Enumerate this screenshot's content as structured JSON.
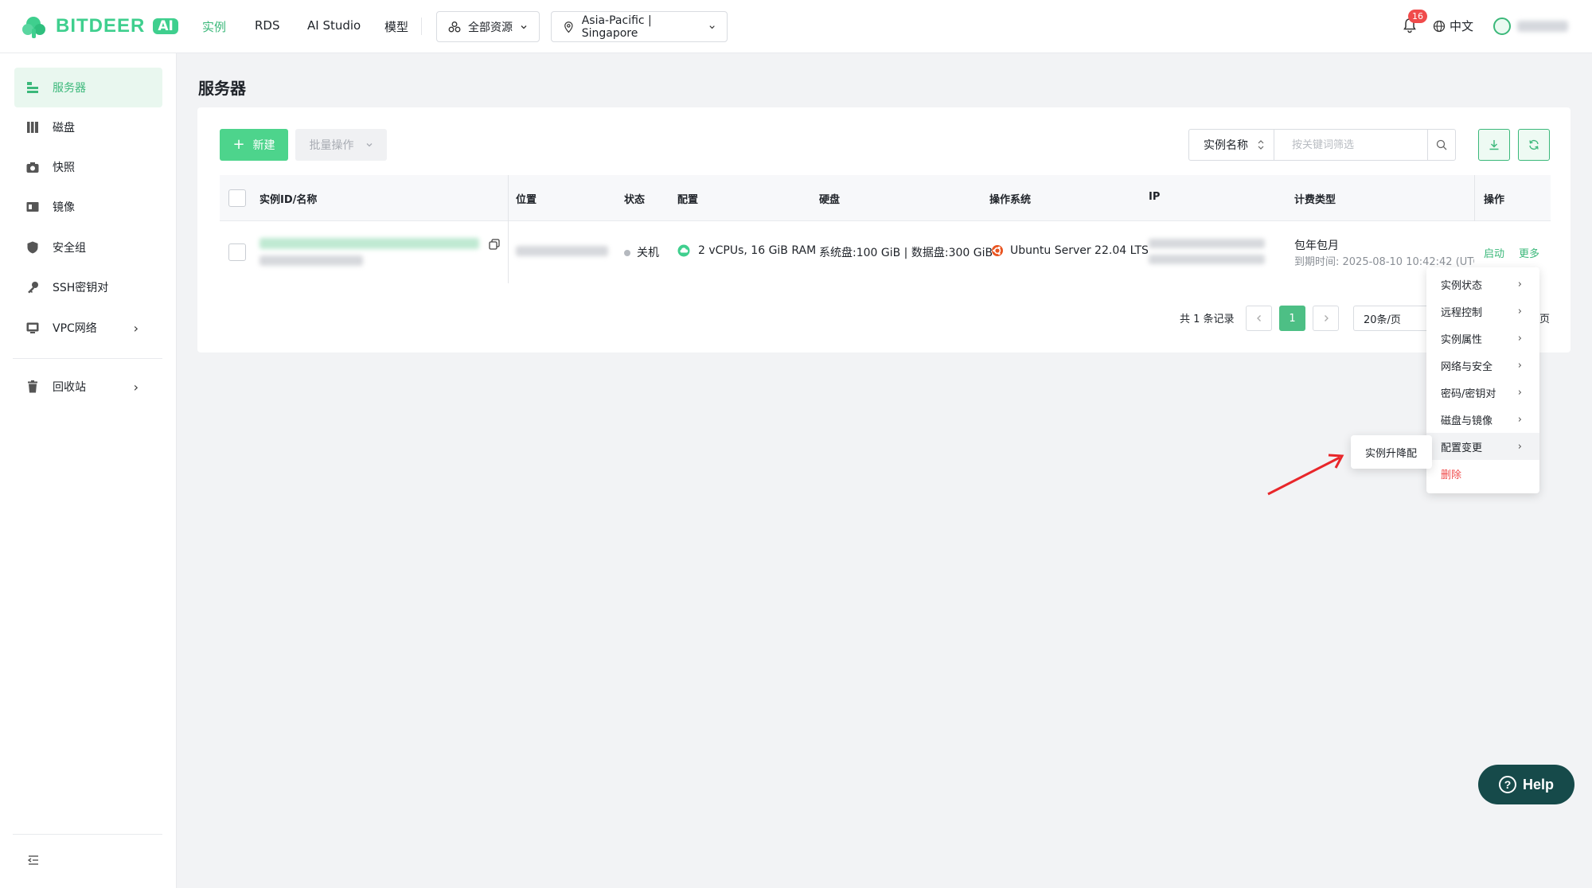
{
  "brand": {
    "name": "BITDEER",
    "suffix": "AI",
    "color": "#3fcf8e"
  },
  "nav": {
    "items": [
      {
        "label": "实例",
        "active": true
      },
      {
        "label": "RDS"
      },
      {
        "label": "AI Studio"
      },
      {
        "label": "模型"
      }
    ],
    "resource_dropdown": "全部资源",
    "region_dropdown": "Asia-Pacific | Singapore"
  },
  "header": {
    "notification_count": "16",
    "language": "中文"
  },
  "sidebar": {
    "items": [
      {
        "label": "服务器",
        "icon": "server-icon",
        "active": true
      },
      {
        "label": "磁盘",
        "icon": "disk-icon"
      },
      {
        "label": "快照",
        "icon": "camera-icon"
      },
      {
        "label": "镜像",
        "icon": "image-icon"
      },
      {
        "label": "安全组",
        "icon": "shield-icon"
      },
      {
        "label": "SSH密钥对",
        "icon": "key-icon"
      },
      {
        "label": "VPC网络",
        "icon": "network-icon"
      },
      {
        "label": "回收站",
        "icon": "trash-icon"
      }
    ]
  },
  "page": {
    "title": "服务器"
  },
  "toolbar": {
    "new_label": "新建",
    "batch_label": "批量操作",
    "search_field": "实例名称",
    "search_placeholder": "按关键词筛选"
  },
  "table": {
    "columns": [
      "实例ID/名称",
      "位置",
      "状态",
      "配置",
      "硬盘",
      "操作系统",
      "IP",
      "计费类型",
      "操作"
    ],
    "rows": [
      {
        "status": "关机",
        "config": "2 vCPUs, 16 GiB RAM",
        "disk": "系统盘:100 GiB | 数据盘:300 GiB",
        "os": "Ubuntu Server 22.04 LTS",
        "billing": "包年包月",
        "expire": "到期时间: 2025-08-10 10:42:42 (UTC",
        "action_start": "启动",
        "action_more": "更多"
      }
    ]
  },
  "pagination": {
    "total": "共 1 条记录",
    "current_page": "1",
    "page_size": "20条/页",
    "suffix": "页"
  },
  "more_menu": {
    "items": [
      {
        "label": "实例状态"
      },
      {
        "label": "远程控制"
      },
      {
        "label": "实例属性"
      },
      {
        "label": "网络与安全"
      },
      {
        "label": "密码/密钥对"
      },
      {
        "label": "磁盘与镜像"
      },
      {
        "label": "配置变更",
        "hover": true
      },
      {
        "label": "删除",
        "danger": true
      }
    ]
  },
  "submenu": {
    "label": "实例升降配"
  },
  "help": {
    "label": "Help"
  }
}
